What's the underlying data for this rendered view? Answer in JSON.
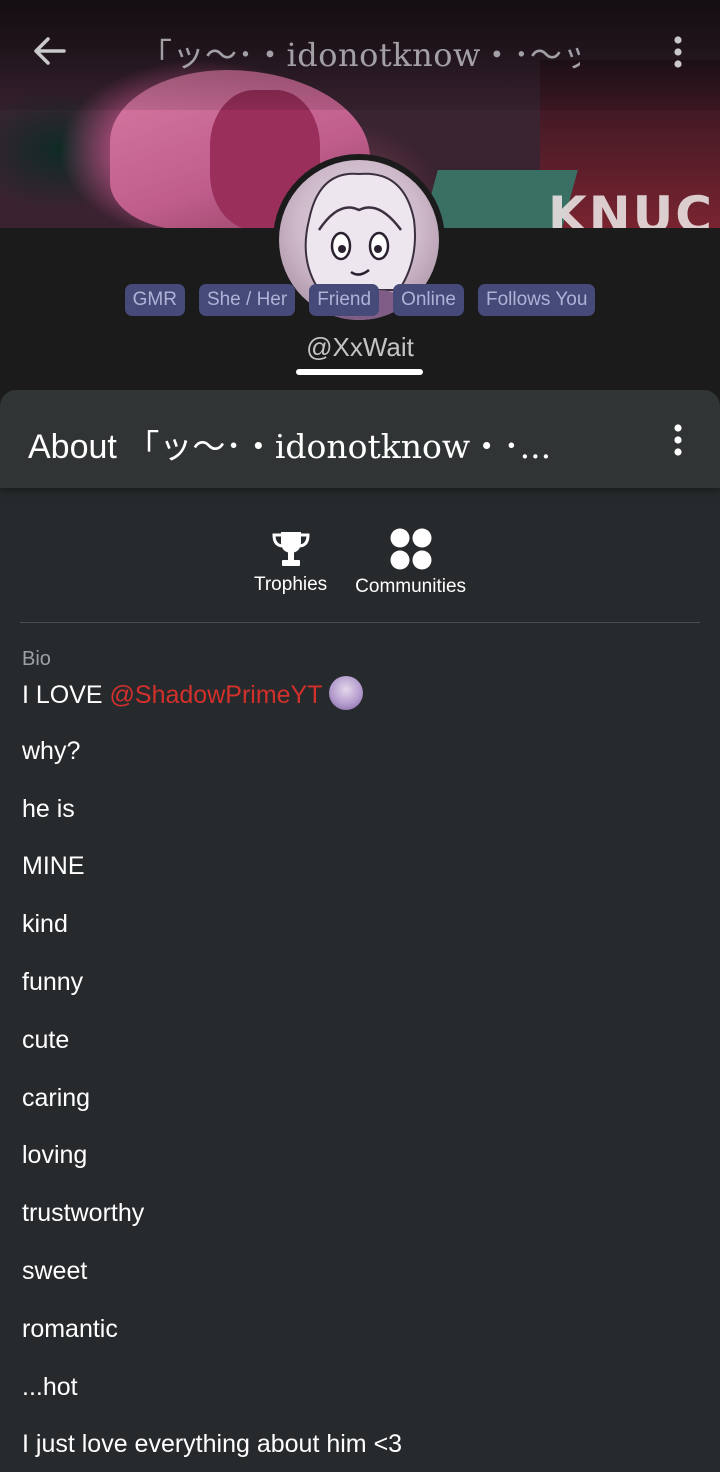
{
  "header": {
    "title": "「ッ〜･・idonotknow・･〜ッ",
    "back_icon": "arrow-left-icon",
    "menu_icon": "more-vertical-icon"
  },
  "banner": {
    "text": "KNUC"
  },
  "profile": {
    "badges": [
      "GMR",
      "She / Her",
      "Friend",
      "Online",
      "Follows You"
    ],
    "username": "@XxWait"
  },
  "about": {
    "title_prefix": "About",
    "title_name": "「ッ〜･・idonotknow・･...",
    "menu_icon": "more-vertical-icon"
  },
  "shortcuts": {
    "trophies": "Trophies",
    "communities": "Communities"
  },
  "bio": {
    "label": "Bio",
    "first_line_text": "I LOVE ",
    "mention": "@ShadowPrimeYT",
    "lines": [
      "why?",
      "he is",
      "MINE",
      "kind",
      "funny",
      "cute",
      "caring",
      "loving",
      "trustworthy",
      "sweet",
      "romantic",
      "...hot",
      "I just love everything about him <3"
    ]
  },
  "colors": {
    "badge_bg": "#454a78",
    "mention": "#d3302c",
    "panel_bg": "#262a2c"
  }
}
